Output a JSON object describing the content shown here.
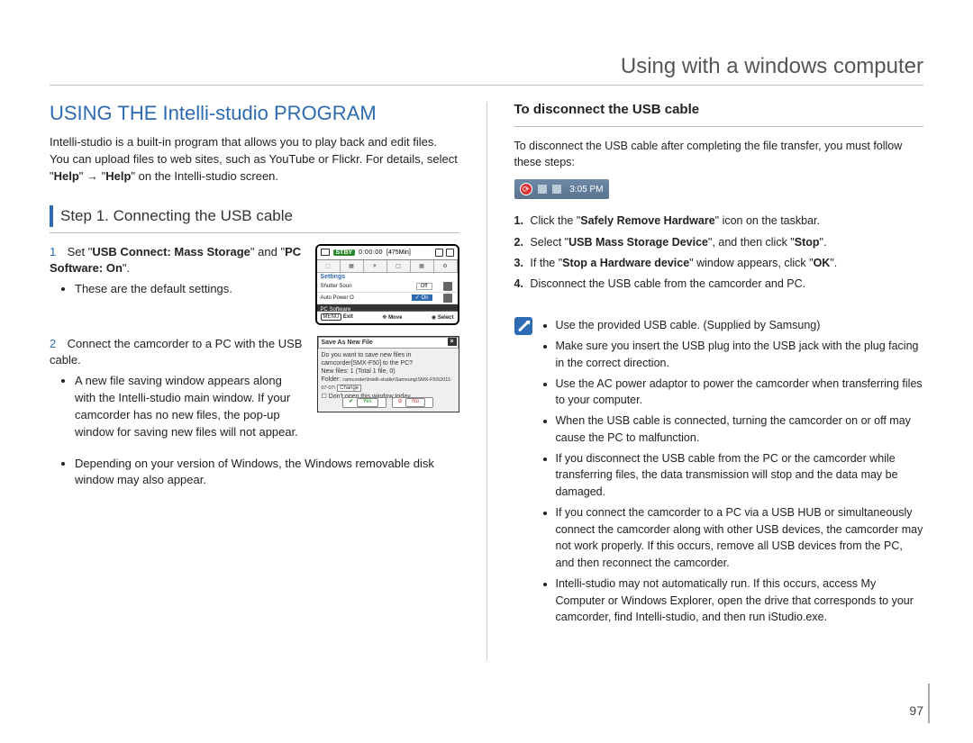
{
  "header": {
    "title": "Using with a windows computer"
  },
  "left": {
    "section_title": "USING THE Intelli-studio PROGRAM",
    "intro_pre": "Intelli-studio is a built-in program that allows you to play back and edit files. You can upload files to web sites, such as YouTube or Flickr. For details, select \"",
    "intro_help1": "Help",
    "intro_arrow": "\" → \"",
    "intro_help2": "Help",
    "intro_post": "\" on the Intelli-studio screen.",
    "step1": {
      "heading": "Step 1. Connecting the USB cable",
      "num1": "1",
      "item1_pre": "Set \"",
      "item1_bold": "USB Connect: Mass Storage",
      "item1_mid": "\" and \"",
      "item1_bold2": "PC Software: On",
      "item1_post": "\".",
      "item1_bullet": "These are the default settings.",
      "num2": "2",
      "item2": "Connect the camcorder to a PC with the USB cable.",
      "item2_b1": "A new file saving window appears along with the Intelli-studio main window. If your camcorder has no new files, the pop-up window for saving new files will not appear.",
      "item2_b2": "Depending on your version of Windows, the Windows removable disk window may also appear."
    },
    "screenshot_a": {
      "stby": "STBY",
      "tc": "0:00:00",
      "rem": "[475Min]",
      "settings": "Settings",
      "row_shutter": "Shutter Soun",
      "val_off": "Off",
      "row_auto": "Auto Power O",
      "val_on": "On",
      "row_pc": "PC Software",
      "bot_menu": "MENU",
      "bot_exit": "Exit",
      "bot_move": "Move",
      "bot_select": "Select"
    },
    "screenshot_b": {
      "title": "Save As New File",
      "q": "Do you want to save new files in camcorder[SMX-F50] to the PC?",
      "line2_lbl": "New files:",
      "line2_val": "1 (Total 1 file, 0)",
      "line3_lbl": "Folder:",
      "line3_val": "camcorder\\Intelli-studio\\Samsung\\SMX-F50\\2011-07-07\\",
      "change": "Change",
      "dont": "Don't open this window today",
      "yes": "Yes",
      "no": "No"
    }
  },
  "right": {
    "sub_heading": "To disconnect the USB cable",
    "para": "To disconnect the USB cable after completing the file transfer, you must follow these steps:",
    "taskbar_time": "3:05 PM",
    "steps": {
      "n1": "1.",
      "s1_pre": "Click the \"",
      "s1_b": "Safely Remove Hardware",
      "s1_post": "\" icon on the taskbar.",
      "n2": "2.",
      "s2_pre": "Select \"",
      "s2_b": "USB Mass Storage Device",
      "s2_mid": "\", and then click \"",
      "s2_b2": "Stop",
      "s2_post": "\".",
      "n3": "3.",
      "s3_pre": "If the \"",
      "s3_b": "Stop a Hardware device",
      "s3_mid": "\" window appears, click \"",
      "s3_b2": "OK",
      "s3_post": "\".",
      "n4": "4.",
      "s4": "Disconnect the USB cable from the camcorder and PC."
    },
    "notes": {
      "b1": "Use the provided USB cable. (Supplied by Samsung)",
      "b2": "Make sure you insert the USB plug into the USB jack with the plug facing in the correct direction.",
      "b3": "Use the AC power adaptor to power the camcorder when transferring files to your computer.",
      "b4": "When the USB cable is connected, turning the camcorder on or off may cause the PC to malfunction.",
      "b5": "If you disconnect the USB cable from the PC or the camcorder while transferring files, the data transmission will stop and the data may be damaged.",
      "b6": "If you connect the camcorder to a PC via a USB HUB or simultaneously connect the camcorder along with other USB devices, the camcorder may not work properly. If this occurs, remove all USB devices from the PC, and then reconnect the camcorder.",
      "b7": "Intelli-studio may not automatically run. If this occurs, access My Computer or Windows Explorer, open the drive that corresponds to your camcorder, find Intelli-studio, and then run iStudio.exe."
    }
  },
  "page_number": "97"
}
